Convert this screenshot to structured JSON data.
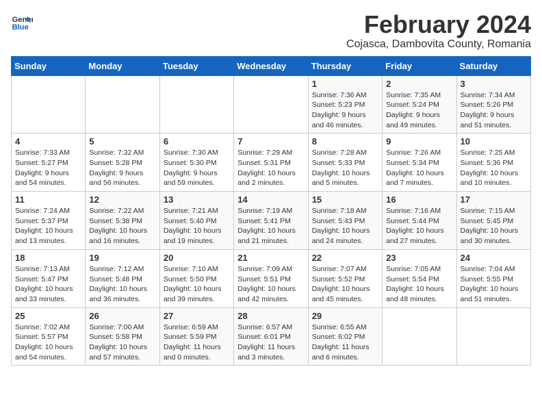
{
  "logo": {
    "line1": "General",
    "line2": "Blue"
  },
  "title": "February 2024",
  "subtitle": "Cojasca, Dambovita County, Romania",
  "days_of_week": [
    "Sunday",
    "Monday",
    "Tuesday",
    "Wednesday",
    "Thursday",
    "Friday",
    "Saturday"
  ],
  "weeks": [
    [
      {
        "day": "",
        "info": ""
      },
      {
        "day": "",
        "info": ""
      },
      {
        "day": "",
        "info": ""
      },
      {
        "day": "",
        "info": ""
      },
      {
        "day": "1",
        "info": "Sunrise: 7:36 AM\nSunset: 5:23 PM\nDaylight: 9 hours\nand 46 minutes."
      },
      {
        "day": "2",
        "info": "Sunrise: 7:35 AM\nSunset: 5:24 PM\nDaylight: 9 hours\nand 49 minutes."
      },
      {
        "day": "3",
        "info": "Sunrise: 7:34 AM\nSunset: 5:26 PM\nDaylight: 9 hours\nand 51 minutes."
      }
    ],
    [
      {
        "day": "4",
        "info": "Sunrise: 7:33 AM\nSunset: 5:27 PM\nDaylight: 9 hours\nand 54 minutes."
      },
      {
        "day": "5",
        "info": "Sunrise: 7:32 AM\nSunset: 5:28 PM\nDaylight: 9 hours\nand 56 minutes."
      },
      {
        "day": "6",
        "info": "Sunrise: 7:30 AM\nSunset: 5:30 PM\nDaylight: 9 hours\nand 59 minutes."
      },
      {
        "day": "7",
        "info": "Sunrise: 7:29 AM\nSunset: 5:31 PM\nDaylight: 10 hours\nand 2 minutes."
      },
      {
        "day": "8",
        "info": "Sunrise: 7:28 AM\nSunset: 5:33 PM\nDaylight: 10 hours\nand 5 minutes."
      },
      {
        "day": "9",
        "info": "Sunrise: 7:26 AM\nSunset: 5:34 PM\nDaylight: 10 hours\nand 7 minutes."
      },
      {
        "day": "10",
        "info": "Sunrise: 7:25 AM\nSunset: 5:36 PM\nDaylight: 10 hours\nand 10 minutes."
      }
    ],
    [
      {
        "day": "11",
        "info": "Sunrise: 7:24 AM\nSunset: 5:37 PM\nDaylight: 10 hours\nand 13 minutes."
      },
      {
        "day": "12",
        "info": "Sunrise: 7:22 AM\nSunset: 5:38 PM\nDaylight: 10 hours\nand 16 minutes."
      },
      {
        "day": "13",
        "info": "Sunrise: 7:21 AM\nSunset: 5:40 PM\nDaylight: 10 hours\nand 19 minutes."
      },
      {
        "day": "14",
        "info": "Sunrise: 7:19 AM\nSunset: 5:41 PM\nDaylight: 10 hours\nand 21 minutes."
      },
      {
        "day": "15",
        "info": "Sunrise: 7:18 AM\nSunset: 5:43 PM\nDaylight: 10 hours\nand 24 minutes."
      },
      {
        "day": "16",
        "info": "Sunrise: 7:16 AM\nSunset: 5:44 PM\nDaylight: 10 hours\nand 27 minutes."
      },
      {
        "day": "17",
        "info": "Sunrise: 7:15 AM\nSunset: 5:45 PM\nDaylight: 10 hours\nand 30 minutes."
      }
    ],
    [
      {
        "day": "18",
        "info": "Sunrise: 7:13 AM\nSunset: 5:47 PM\nDaylight: 10 hours\nand 33 minutes."
      },
      {
        "day": "19",
        "info": "Sunrise: 7:12 AM\nSunset: 5:48 PM\nDaylight: 10 hours\nand 36 minutes."
      },
      {
        "day": "20",
        "info": "Sunrise: 7:10 AM\nSunset: 5:50 PM\nDaylight: 10 hours\nand 39 minutes."
      },
      {
        "day": "21",
        "info": "Sunrise: 7:09 AM\nSunset: 5:51 PM\nDaylight: 10 hours\nand 42 minutes."
      },
      {
        "day": "22",
        "info": "Sunrise: 7:07 AM\nSunset: 5:52 PM\nDaylight: 10 hours\nand 45 minutes."
      },
      {
        "day": "23",
        "info": "Sunrise: 7:05 AM\nSunset: 5:54 PM\nDaylight: 10 hours\nand 48 minutes."
      },
      {
        "day": "24",
        "info": "Sunrise: 7:04 AM\nSunset: 5:55 PM\nDaylight: 10 hours\nand 51 minutes."
      }
    ],
    [
      {
        "day": "25",
        "info": "Sunrise: 7:02 AM\nSunset: 5:57 PM\nDaylight: 10 hours\nand 54 minutes."
      },
      {
        "day": "26",
        "info": "Sunrise: 7:00 AM\nSunset: 5:58 PM\nDaylight: 10 hours\nand 57 minutes."
      },
      {
        "day": "27",
        "info": "Sunrise: 6:59 AM\nSunset: 5:59 PM\nDaylight: 11 hours\nand 0 minutes."
      },
      {
        "day": "28",
        "info": "Sunrise: 6:57 AM\nSunset: 6:01 PM\nDaylight: 11 hours\nand 3 minutes."
      },
      {
        "day": "29",
        "info": "Sunrise: 6:55 AM\nSunset: 6:02 PM\nDaylight: 11 hours\nand 6 minutes."
      },
      {
        "day": "",
        "info": ""
      },
      {
        "day": "",
        "info": ""
      }
    ]
  ]
}
